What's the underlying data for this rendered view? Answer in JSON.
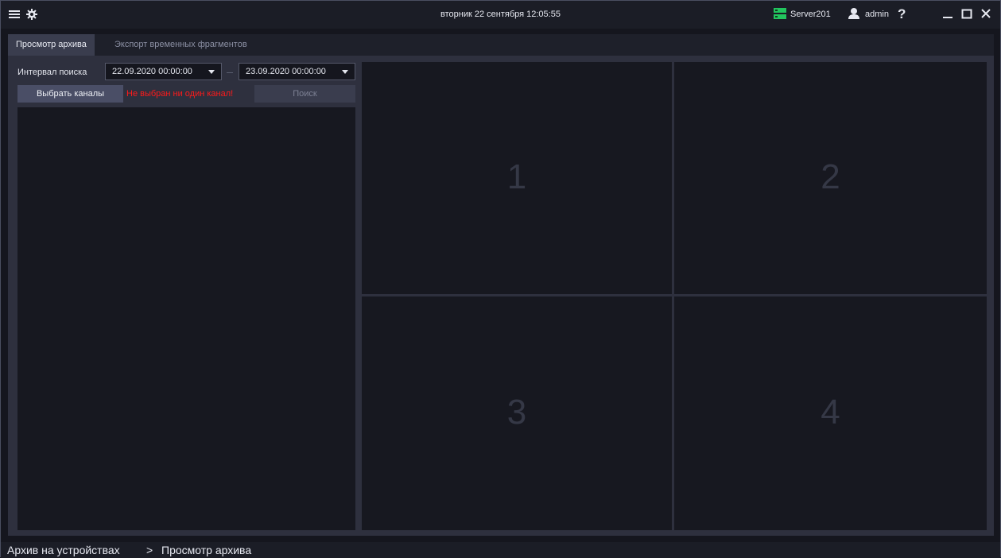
{
  "titlebar": {
    "datetime": "вторник 22 сентября 12:05:55",
    "server_name": "Server201",
    "user_name": "admin",
    "help_label": "?"
  },
  "tabs": [
    {
      "label": "Просмотр архива",
      "active": true
    },
    {
      "label": "Экспорт временных фрагментов",
      "active": false
    }
  ],
  "search": {
    "interval_label": "Интервал поиска",
    "date_from": "22.09.2020  00:00:00",
    "date_to": "23.09.2020  00:00:00",
    "select_channels_label": "Выбрать каналы",
    "error_text": "Не выбран ни один канал!",
    "search_label": "Поиск"
  },
  "video_grid": {
    "cells": [
      "1",
      "2",
      "3",
      "4"
    ]
  },
  "breadcrumb": {
    "root": "Архив на устройствах",
    "separator": ">",
    "current": "Просмотр архива"
  },
  "colors": {
    "server_status": "#22c55e",
    "error": "#ff1a1a",
    "accent_button": "#4a4e66"
  }
}
